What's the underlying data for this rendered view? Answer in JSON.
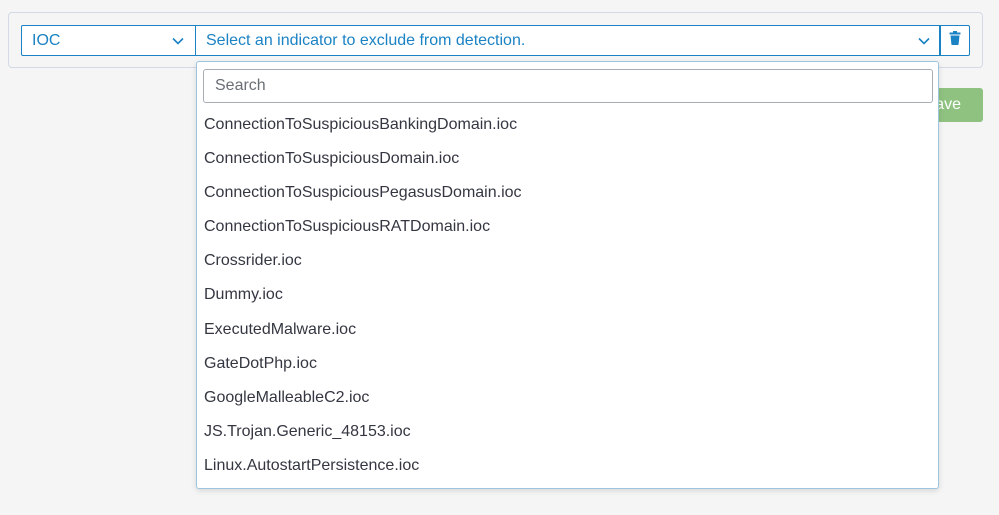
{
  "filter_row": {
    "type_select": {
      "value": "IOC",
      "icon": "chevron-down-icon"
    },
    "indicator_select": {
      "placeholder": "Select an indicator to exclude from detection.",
      "icon": "chevron-down-icon"
    },
    "delete_button": {
      "icon": "trash-icon"
    }
  },
  "save_button": {
    "label": "Save"
  },
  "dropdown": {
    "search_placeholder": "Search",
    "options": [
      "ConnectionToSuspiciousBankingDomain.ioc",
      "ConnectionToSuspiciousDomain.ioc",
      "ConnectionToSuspiciousPegasusDomain.ioc",
      "ConnectionToSuspiciousRATDomain.ioc",
      "Crossrider.ioc",
      "Dummy.ioc",
      "ExecutedMalware.ioc",
      "GateDotPhp.ioc",
      "GoogleMalleableC2.ioc",
      "JS.Trojan.Generic_48153.ioc",
      "Linux.AutostartPersistence.ioc"
    ]
  },
  "colors": {
    "accent": "#1b82c4",
    "save_button_bg": "#8fc280",
    "background": "#f5f5f5"
  }
}
